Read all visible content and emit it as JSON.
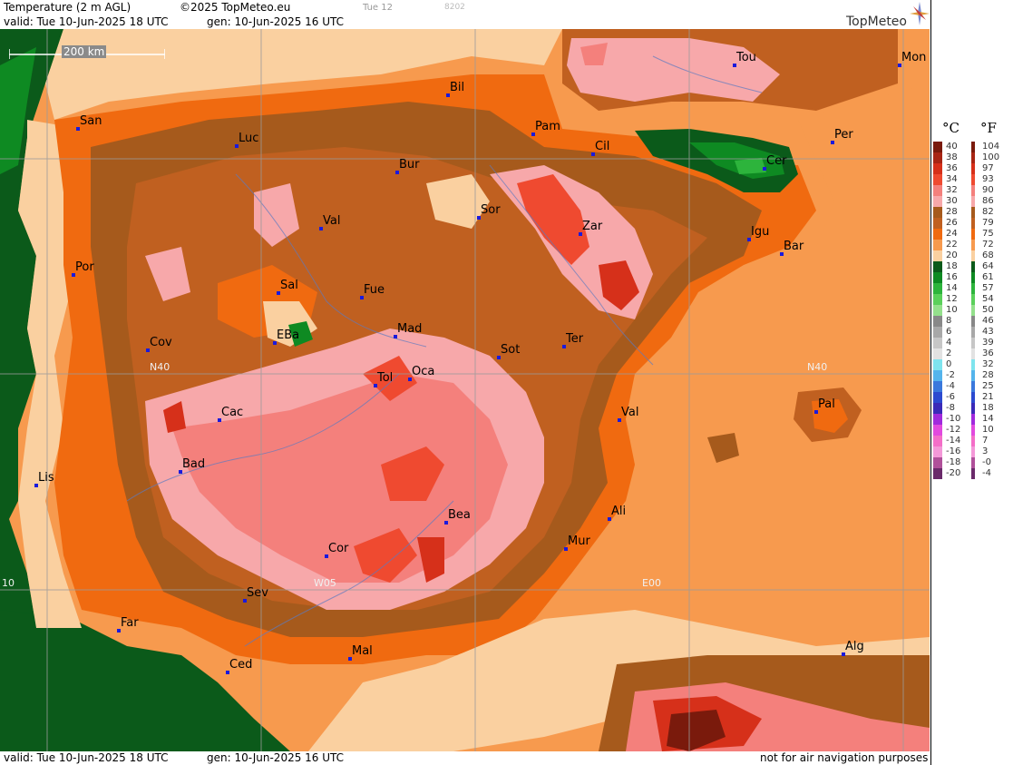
{
  "header": {
    "title": "Temperature (2 m AGL)",
    "copyright": "©2025 TopMeteo.eu",
    "tab": "Tue 12",
    "code": "8202",
    "valid": "valid:  Tue  10-Jun-2025  18 UTC",
    "gen": "gen: 10-Jun-2025 16 UTC"
  },
  "footer": {
    "valid": "valid:  Tue  10-Jun-2025  18 UTC",
    "gen": "gen: 10-Jun-2025 16 UTC",
    "note": "not for air navigation purposes"
  },
  "logo": {
    "text": "TopMeteo",
    "icon": "compass-star-icon"
  },
  "scale_bar": {
    "label": "200 km"
  },
  "grid_labels": {
    "lat40_w": "N40",
    "lat40_e": "N40",
    "lon05w": "W05",
    "lon00": "E00",
    "lon10w": "10"
  },
  "cities": [
    {
      "name": "Bil"
    },
    {
      "name": "Tou"
    },
    {
      "name": "Mon"
    },
    {
      "name": "San"
    },
    {
      "name": "Luc"
    },
    {
      "name": "Pam"
    },
    {
      "name": "Cil"
    },
    {
      "name": "Per"
    },
    {
      "name": "Bur"
    },
    {
      "name": "Cer"
    },
    {
      "name": "Sor"
    },
    {
      "name": "Val"
    },
    {
      "name": "Zar"
    },
    {
      "name": "Igu"
    },
    {
      "name": "Bar"
    },
    {
      "name": "Por"
    },
    {
      "name": "Sal"
    },
    {
      "name": "Fue"
    },
    {
      "name": "Mad"
    },
    {
      "name": "EBa"
    },
    {
      "name": "Ter"
    },
    {
      "name": "Cov"
    },
    {
      "name": "Sot"
    },
    {
      "name": "Tol"
    },
    {
      "name": "Oca"
    },
    {
      "name": "Pal"
    },
    {
      "name": "Cac"
    },
    {
      "name": "Val"
    },
    {
      "name": "Bad"
    },
    {
      "name": "Lis"
    },
    {
      "name": "Ali"
    },
    {
      "name": "Bea"
    },
    {
      "name": "Mur"
    },
    {
      "name": "Cor"
    },
    {
      "name": "Sev"
    },
    {
      "name": "Far"
    },
    {
      "name": "Mal"
    },
    {
      "name": "Ced"
    },
    {
      "name": "Alg"
    }
  ],
  "legend": {
    "unit_c": "°C",
    "unit_f": "°F",
    "celsius": [
      "40",
      "38",
      "36",
      "34",
      "32",
      "30",
      "28",
      "26",
      "24",
      "22",
      "20",
      "18",
      "16",
      "14",
      "12",
      "10",
      "8",
      "6",
      "4",
      "2",
      "0",
      "-2",
      "-4",
      "-6",
      "-8",
      "-10",
      "-12",
      "-14",
      "-16",
      "-18",
      "-20"
    ],
    "fahrenheit": [
      "104",
      "100",
      "97",
      "93",
      "90",
      "86",
      "82",
      "79",
      "75",
      "72",
      "68",
      "64",
      "61",
      "57",
      "54",
      "50",
      "46",
      "43",
      "39",
      "36",
      "32",
      "28",
      "25",
      "21",
      "18",
      "14",
      "10",
      "7",
      "3",
      "-0",
      "-4"
    ],
    "colors": [
      "#7a1a0c",
      "#a82514",
      "#d6301a",
      "#ef4a30",
      "#f4807c",
      "#f7a8aa",
      "#a65a1c",
      "#c06020",
      "#f06a10",
      "#f79a4e",
      "#fad0a0",
      "#0b5a1a",
      "#0e8a22",
      "#2db43c",
      "#5ad05a",
      "#94e08c",
      "#888888",
      "#a8a8a8",
      "#c6c6c6",
      "#e2e2e2",
      "#7ee4ee",
      "#54b4ec",
      "#3a78dc",
      "#2c4ad0",
      "#3a2ab8",
      "#a02adc",
      "#e24ade",
      "#f46ec8",
      "#f498d8",
      "#b0509a",
      "#6a2a6a"
    ]
  }
}
